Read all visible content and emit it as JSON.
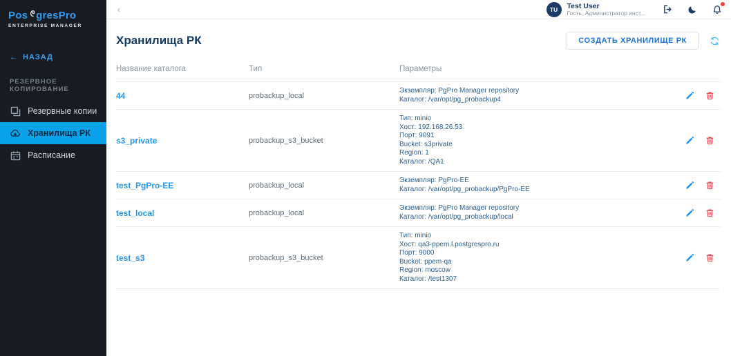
{
  "brand": {
    "logo_pre": "Pos",
    "logo_post": "gresPro",
    "subtitle": "ENTERPRISE MANAGER"
  },
  "sidebar": {
    "back_label": "НАЗАД",
    "section_label": "РЕЗЕРВНОЕ КОПИРОВАНИЕ",
    "items": [
      {
        "label": "Резервные копии",
        "icon": "backup-copies-icon",
        "active": false
      },
      {
        "label": "Хранилища РК",
        "icon": "cloud-upload-icon",
        "active": true
      },
      {
        "label": "Расписание",
        "icon": "calendar-icon",
        "active": false
      }
    ]
  },
  "topbar": {
    "collapse_glyph": "‹",
    "user": {
      "initials": "TU",
      "name": "Test User",
      "role": "Гость, Администратор инст..."
    }
  },
  "page": {
    "title": "Хранилища РК",
    "create_button_label": "СОЗДАТЬ ХРАНИЛИЩЕ РК"
  },
  "table": {
    "headers": [
      "Название каталога",
      "Тип",
      "Параметры"
    ],
    "rows": [
      {
        "name": "44",
        "type": "probackup_local",
        "params": [
          "Экземпляр: PgPro Manager repository",
          "Каталог: /var/opt/pg_probackup4"
        ]
      },
      {
        "name": "s3_private",
        "type": "probackup_s3_bucket",
        "params": [
          "Тип: minio",
          "Хост: 192.168.26.53",
          "Порт: 9091",
          "Bucket: s3private",
          "Region: 1",
          "Каталог: /QA1"
        ]
      },
      {
        "name": "test_PgPro-EE",
        "type": "probackup_local",
        "params": [
          "Экземпляр: PgPro-EE",
          "Каталог: /var/opt/pg_probackup/PgPro-EE"
        ]
      },
      {
        "name": "test_local",
        "type": "probackup_local",
        "params": [
          "Экземпляр: PgPro Manager repository",
          "Каталог: /var/opt/pg_probackup/local"
        ]
      },
      {
        "name": "test_s3",
        "type": "probackup_s3_bucket",
        "params": [
          "Тип: minio",
          "Хост: qa3-ppem.l.postgrespro.ru",
          "Порт: 9000",
          "Bucket: ppem-qa",
          "Region: moscow",
          "Каталог: /test1307"
        ]
      }
    ]
  },
  "colors": {
    "sidebar_bg": "#181c22",
    "accent_active": "#0aa3e9",
    "brand_blue": "#2e9bf0",
    "link_blue": "#2196f3",
    "params_blue": "#2b5e91",
    "danger_red": "#e5484d",
    "navy": "#1d3a66"
  }
}
